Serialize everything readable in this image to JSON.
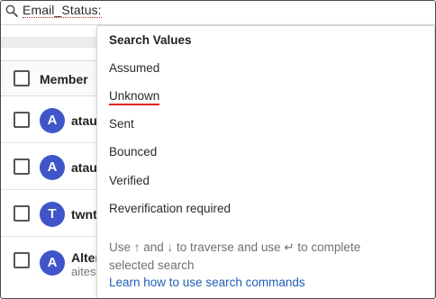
{
  "search": {
    "value": "Email_Status:"
  },
  "table": {
    "header": {
      "member_label": "Member"
    },
    "rows": [
      {
        "avatar_letter": "A",
        "name": "atau",
        "sub": "",
        "tail": ""
      },
      {
        "avatar_letter": "A",
        "name": "atau",
        "sub": "",
        "tail": ""
      },
      {
        "avatar_letter": "T",
        "name": "twnt",
        "sub": "",
        "tail": "g"
      },
      {
        "avatar_letter": "A",
        "name": "Alter",
        "sub": "aites",
        "tail": ""
      }
    ]
  },
  "dropdown": {
    "title": "Search Values",
    "items": [
      "Assumed",
      "Unknown",
      "Sent",
      "Bounced",
      "Verified",
      "Reverification required"
    ],
    "highlighted_item": "Unknown",
    "hint": "Use ↑ and ↓ to traverse and use ↵ to complete selected search",
    "link": "Learn how to use search commands"
  },
  "colors": {
    "avatar": "#3f55c9",
    "link": "#1f5fb5",
    "highlight_underline": "#e02020"
  },
  "icons": [
    "search-icon"
  ]
}
